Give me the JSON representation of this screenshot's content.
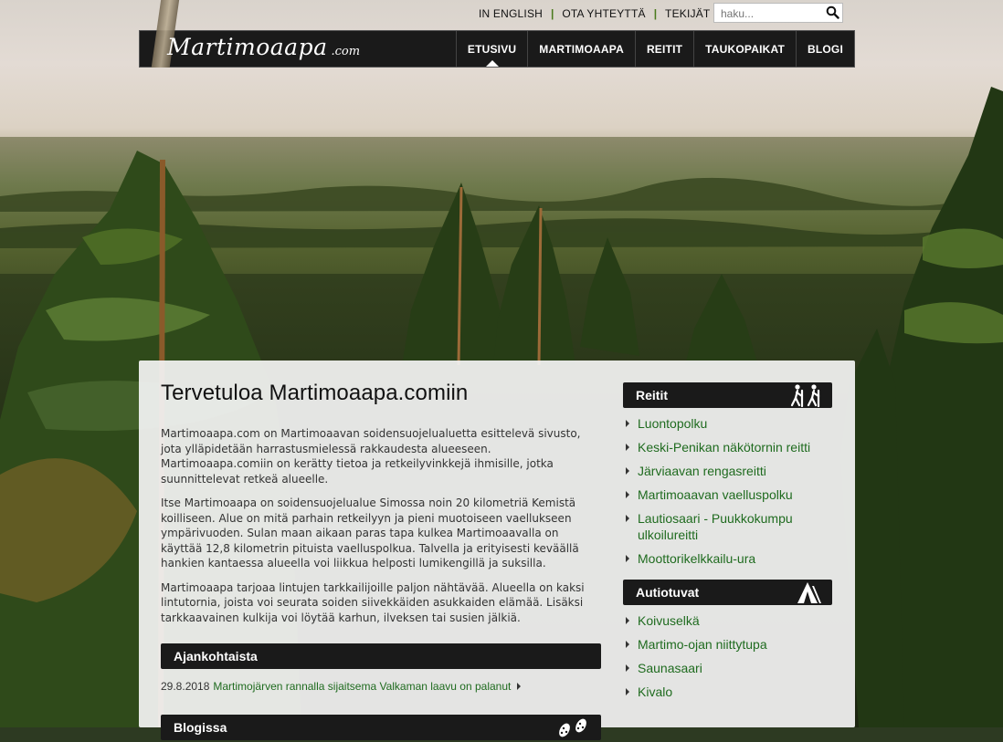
{
  "header": {
    "top_links": [
      "IN ENGLISH",
      "OTA YHTEYTTÄ",
      "TEKIJÄT"
    ],
    "search_placeholder": "haku...",
    "logo_main": "Martimoaapa",
    "logo_domain": ".com"
  },
  "nav": {
    "items": [
      "ETUSIVU",
      "MARTIMOAAPA",
      "REITIT",
      "TAUKOPAIKAT",
      "BLOGI"
    ],
    "active": "ETUSIVU"
  },
  "main": {
    "title": "Tervetuloa Martimoaapa.comiin",
    "paragraphs": [
      "Martimoaapa.com on Martimoaavan soidensuojelualuetta esittelevä sivusto, jota ylläpidetään harrastusmielessä rakkaudesta alueeseen. Martimoaapa.comiin on kerätty tietoa ja retkeilyvinkkejä ihmisille, jotka suunnittelevat retkeä alueelle.",
      "Itse Martimoaapa on soidensuojelualue Simossa noin 20 kilometriä Kemistä koilliseen. Alue on mitä parhain retkeilyyn ja pieni muotoiseen vaellukseen ympärivuoden. Sulan maan aikaan paras tapa kulkea Martimoaavalla on käyttää 12,8 kilometrin pituista vaelluspolkua. Talvella ja erityisesti keväällä hankien kantaessa alueella voi liikkua helposti lumikengillä ja suksilla.",
      "Martimoaapa tarjoaa lintujen tarkkailijoille paljon nähtävää. Alueella on kaksi lintutornia, joista voi seurata soiden siivekkäiden asukkaiden elämää. Lisäksi tarkkaavainen kulkija voi löytää karhun, ilveksen tai susien jälkiä."
    ],
    "news_heading": "Ajankohtaista",
    "news": [
      {
        "date": "29.8.2018",
        "text": "Martimojärven rannalla sijaitsema Valkaman laavu on palanut"
      }
    ],
    "blog_heading": "Blogissa"
  },
  "sidebar": {
    "routes_heading": "Reitit",
    "routes": [
      "Luontopolku",
      "Keski-Penikan näkötornin reitti",
      "Järviaavan rengasreitti",
      "Martimoaavan vaelluspolku",
      "Lautiosaari - Puukkokumpu ulkoilureitti",
      "Moottorikelkkailu-ura"
    ],
    "huts_heading": "Autiotuvat",
    "huts": [
      "Koivuselkä",
      "Martimo-ojan niittytupa",
      "Saunasaari",
      "Kivalo"
    ]
  },
  "colors": {
    "link_green": "#1f6b1f",
    "nav_bg": "#1a1a1a",
    "separator_green": "#4a7a1c"
  },
  "icons": {
    "search": "magnifier-icon",
    "routes": "hikers-icon",
    "huts": "tent-icon",
    "blog": "footprints-icon"
  }
}
